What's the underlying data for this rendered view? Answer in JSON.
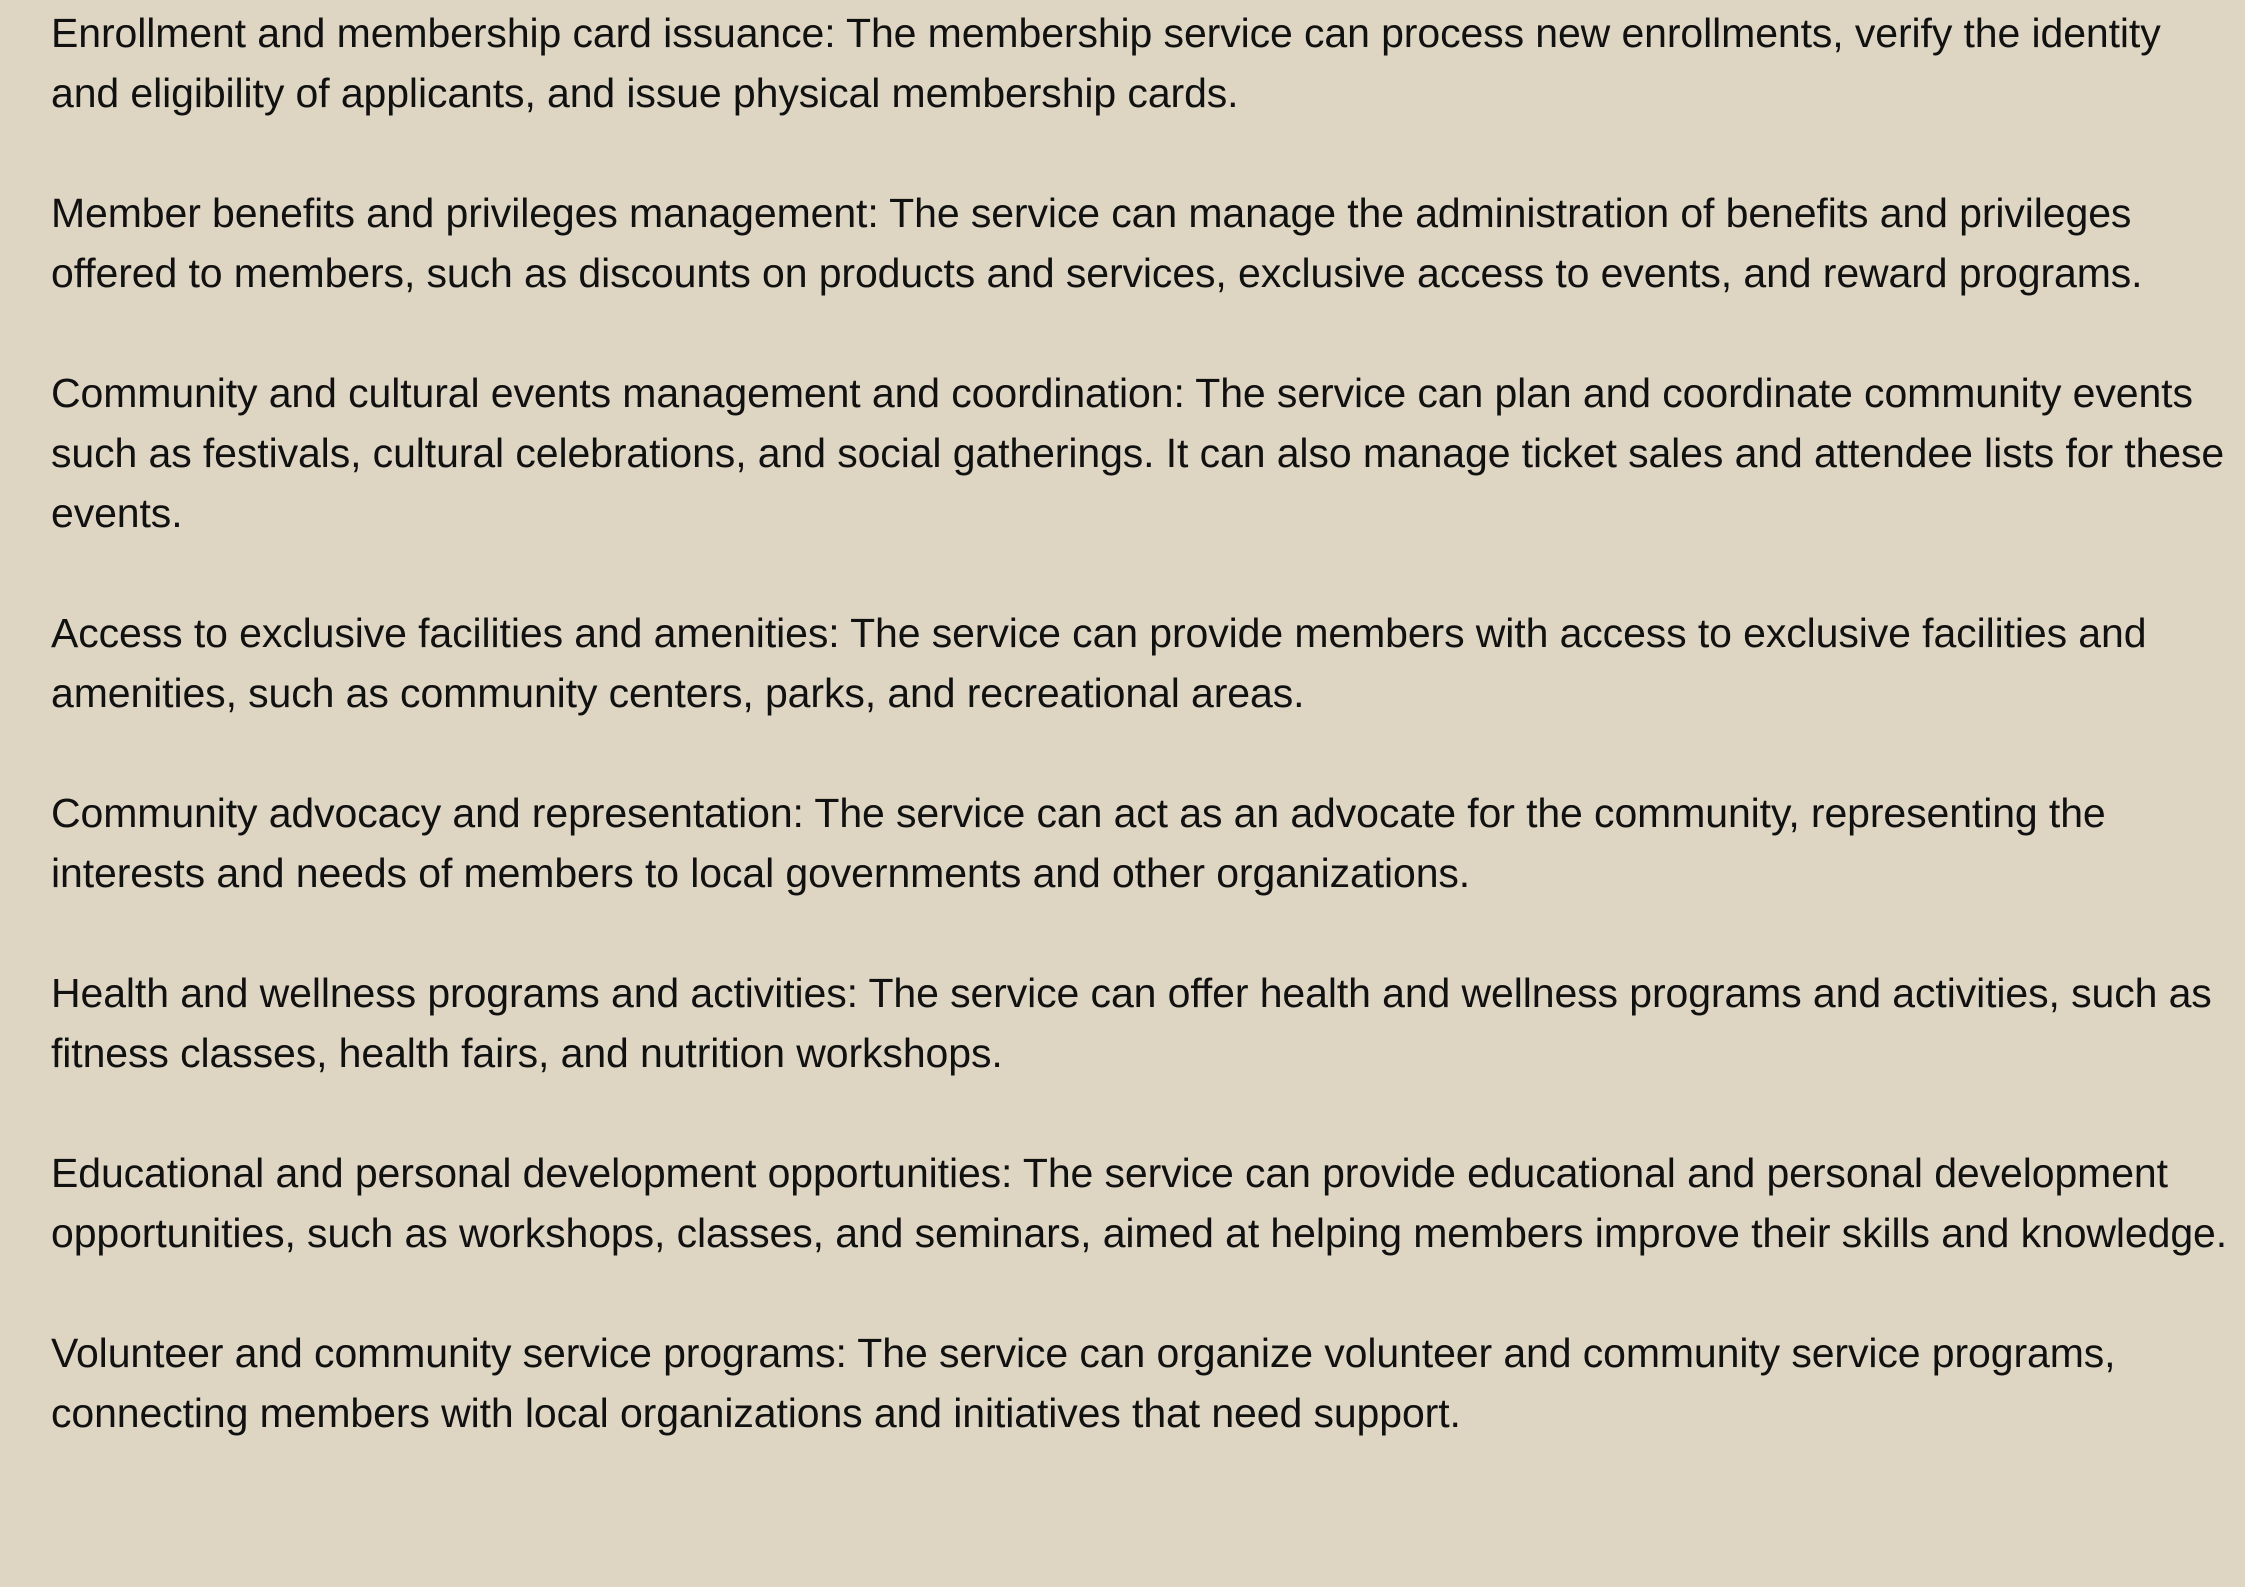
{
  "document": {
    "paragraphs": [
      "Enrollment and membership card issuance: The membership service can process new enrollments, verify the identity and eligibility of applicants, and issue physical membership cards.",
      "Member benefits and privileges management: The service can manage the administration of benefits and privileges offered to members, such as discounts on products and services, exclusive access to events, and reward programs.",
      "Community and cultural events management and coordination: The service can plan and coordinate community events such as festivals, cultural celebrations, and social gatherings. It can also manage ticket sales and attendee lists for these events.",
      "Access to exclusive facilities and amenities: The service can provide members with access to exclusive facilities and amenities, such as community centers, parks, and recreational areas.",
      "Community advocacy and representation: The service can act as an advocate for the community, representing the interests and needs of members to local governments and other organizations.",
      "Health and wellness programs and activities: The service can offer health and wellness programs and activities, such as fitness classes, health fairs, and nutrition workshops.",
      "Educational and personal development opportunities: The service can provide educational and personal development opportunities, such as workshops, classes, and seminars, aimed at helping members improve their skills and knowledge.",
      "Volunteer and community service programs: The service can organize volunteer and community service programs, connecting members with local organizations and initiatives that need support."
    ]
  },
  "colors": {
    "background": "#ded6c3",
    "text": "#111111"
  }
}
